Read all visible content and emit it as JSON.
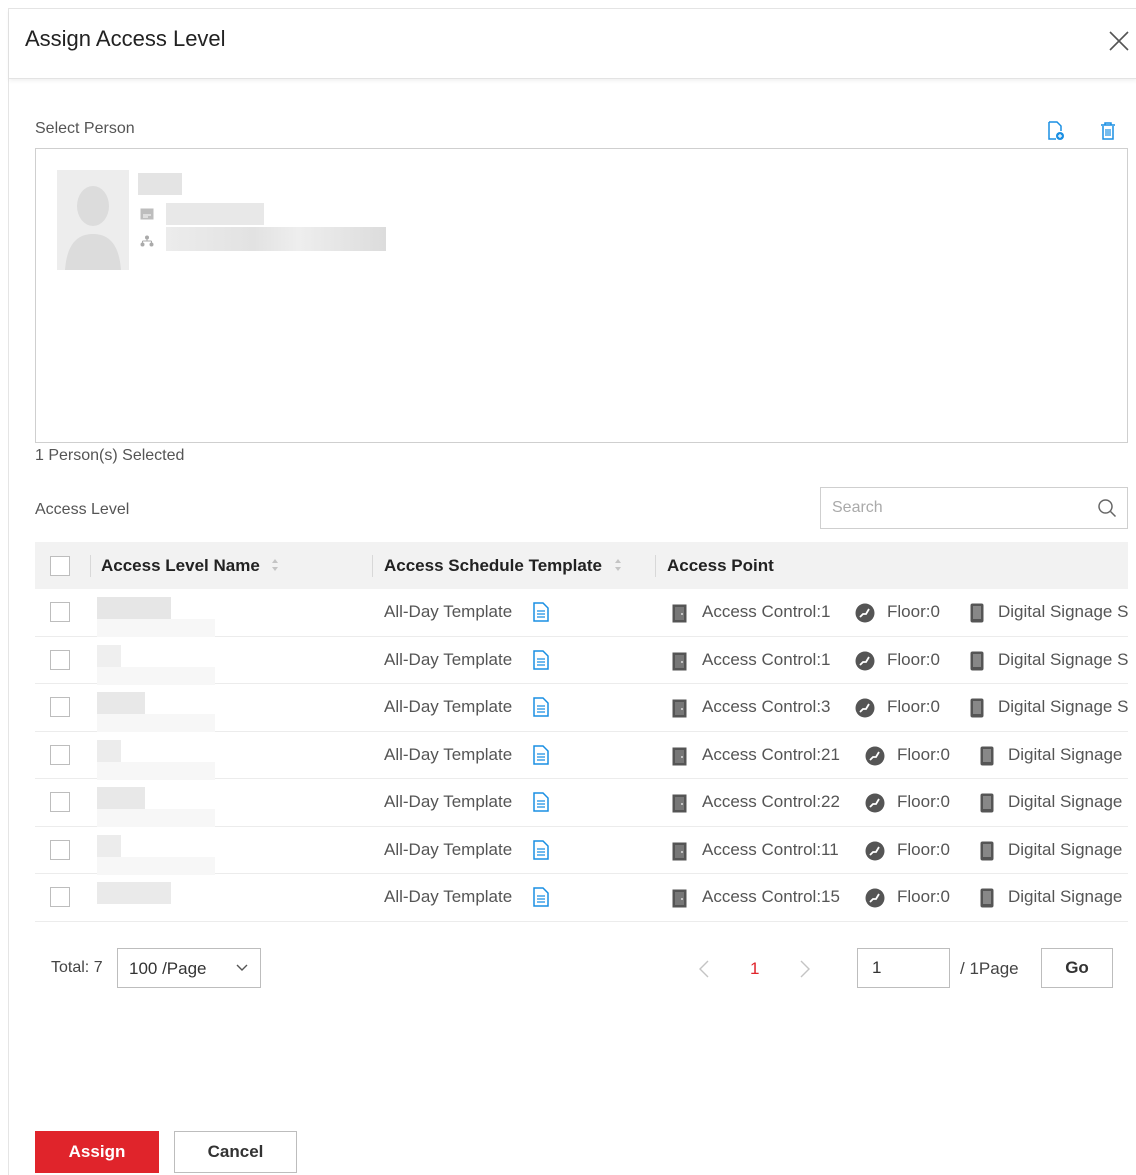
{
  "dialog": {
    "title": "Assign Access Level"
  },
  "select_person": {
    "label": "Select Person",
    "selected_count": "1 Person(s) Selected"
  },
  "access_level": {
    "label": "Access Level",
    "search_placeholder": "Search",
    "columns": {
      "name": "Access Level Name",
      "schedule": "Access Schedule Template",
      "point": "Access Point"
    },
    "rows": [
      {
        "schedule": "All-Day Template",
        "access_control": "Access Control:1",
        "floor": "Floor:0",
        "signage": "Digital Signage S"
      },
      {
        "schedule": "All-Day Template",
        "access_control": "Access Control:1",
        "floor": "Floor:0",
        "signage": "Digital Signage S"
      },
      {
        "schedule": "All-Day Template",
        "access_control": "Access Control:3",
        "floor": "Floor:0",
        "signage": "Digital Signage S"
      },
      {
        "schedule": "All-Day Template",
        "access_control": "Access Control:21",
        "floor": "Floor:0",
        "signage": "Digital Signage"
      },
      {
        "schedule": "All-Day Template",
        "access_control": "Access Control:22",
        "floor": "Floor:0",
        "signage": "Digital Signage"
      },
      {
        "schedule": "All-Day Template",
        "access_control": "Access Control:11",
        "floor": "Floor:0",
        "signage": "Digital Signage"
      },
      {
        "schedule": "All-Day Template",
        "access_control": "Access Control:15",
        "floor": "Floor:0",
        "signage": "Digital Signage"
      }
    ]
  },
  "pagination": {
    "total": "Total: 7",
    "page_size": "100 /Page",
    "current_page": "1",
    "page_input": "1",
    "page_of": "/ 1Page",
    "go_label": "Go"
  },
  "footer": {
    "assign_label": "Assign",
    "cancel_label": "Cancel"
  },
  "colors": {
    "accent": "#e0242b",
    "icon_blue": "#1a8fe3"
  }
}
